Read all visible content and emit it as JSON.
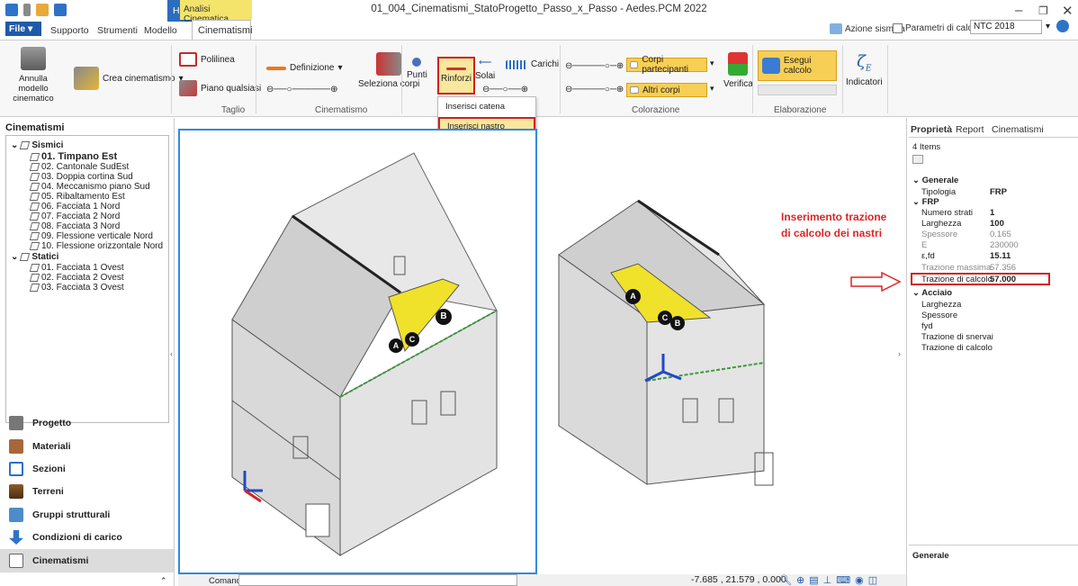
{
  "app": {
    "title": "01_004_Cinematismi_StatoProgetto_Passo_x_Passo - Aedes.PCM 2022",
    "tab_home": "Home",
    "tab_context": "Analisi Cinematica",
    "tab_active": "Cinematismi"
  },
  "menu": {
    "file": "File",
    "items": [
      "Supporto",
      "Strumenti",
      "Modello"
    ]
  },
  "toplinks": {
    "azione": "Azione sismica",
    "parametri": "Parametri di calcolo",
    "norm": "NTC 2018"
  },
  "ribbon": {
    "annulla": "Annulla modello cinematico",
    "crea": "Crea cinematismo",
    "polilinea": "Polilinea",
    "piano": "Piano qualsiasi",
    "definizione": "Definizione",
    "seleziona": "Seleziona corpi",
    "punti": "Punti",
    "rinforzi": "Rinforzi",
    "solai": "Solai",
    "carichi": "Carichi",
    "corpi_partecipanti": "Corpi partecipanti",
    "altri_corpi": "Altri corpi",
    "verifica": "Verifica",
    "esegui": "Esegui calcolo",
    "indicatori": "Indicatori",
    "groups": {
      "taglio": "Taglio",
      "cinematismo": "Cinematismo",
      "colorazione": "Colorazione",
      "elaborazione": "Elaborazione"
    }
  },
  "dropdown": {
    "catena": "Inserisci catena",
    "nastro": "Inserisci nastro"
  },
  "left": {
    "title": "Cinematismi",
    "tree": {
      "sismici": "Sismici",
      "items": [
        "01. Timpano Est",
        "02. Cantonale SudEst",
        "03. Doppia cortina Sud",
        "04. Meccanismo piano Sud",
        "05. Ribaltamento Est",
        "06. Facciata 1 Nord",
        "07. Facciata 2 Nord",
        "08. Facciata 3 Nord",
        "09. Flessione verticale Nord",
        "10. Flessione orizzontale Nord"
      ],
      "statici": "Statici",
      "statici_items": [
        "01. Facciata 1 Ovest",
        "02. Facciata 2 Ovest",
        "03. Facciata 3 Ovest"
      ]
    },
    "nav": [
      "Progetto",
      "Materiali",
      "Sezioni",
      "Terreni",
      "Gruppi strutturali",
      "Condizioni di carico",
      "Cinematismi"
    ]
  },
  "props": {
    "tabs": [
      "Proprietà",
      "Report",
      "Cinematismi"
    ],
    "count": "4 Items",
    "generale": "Generale",
    "tipologia_label": "Tipologia",
    "tipologia": "FRP",
    "frp": "FRP",
    "rows": [
      [
        "Numero strati",
        "1"
      ],
      [
        "Larghezza",
        "100"
      ],
      [
        "Spessore",
        "0.165"
      ],
      [
        "E",
        "230000"
      ],
      [
        "ε,fd",
        "15.11"
      ],
      [
        "Trazione massima",
        "57.356"
      ],
      [
        "Trazione di calcolo",
        "57.000"
      ]
    ],
    "acciaio": "Acciaio",
    "acc_rows": [
      "Larghezza",
      "Spessore",
      "fyd",
      "Trazione di snervai",
      "Trazione di calcolo"
    ],
    "footer": "Generale"
  },
  "annotation": "Inserimento trazione di calcolo dei nastri",
  "status": {
    "cmd": "Comando",
    "coords": "-7.685 , 21.579 , 0.000"
  },
  "labels": [
    "A",
    "B",
    "C"
  ]
}
